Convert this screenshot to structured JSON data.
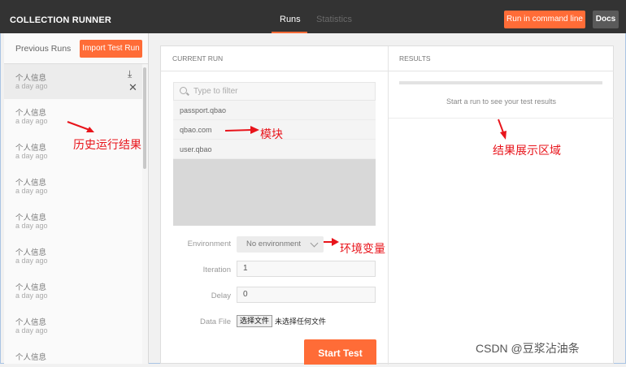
{
  "header": {
    "app_title": "COLLECTION RUNNER",
    "tabs": [
      {
        "label": "Runs",
        "active": true
      },
      {
        "label": "Statistics",
        "active": false
      }
    ],
    "run_cmd_label": "Run in command line",
    "docs_label": "Docs"
  },
  "sidebar": {
    "previous_runs_label": "Previous Runs",
    "import_label": "Import Test Run",
    "runs": [
      {
        "name": "个人信息",
        "time": "a day ago"
      },
      {
        "name": "个人信息",
        "time": "a day ago"
      },
      {
        "name": "个人信息",
        "time": "a day ago"
      },
      {
        "name": "个人信息",
        "time": "a day ago"
      },
      {
        "name": "个人信息",
        "time": "a day ago"
      },
      {
        "name": "个人信息",
        "time": "a day ago"
      },
      {
        "name": "个人信息",
        "time": "a day ago"
      },
      {
        "name": "个人信息",
        "time": "a day ago"
      },
      {
        "name": "个人信息",
        "time": ""
      }
    ],
    "download_icon": "download-icon",
    "close_icon": "close-icon"
  },
  "current_run": {
    "heading": "CURRENT RUN",
    "filter_placeholder": "Type to filter",
    "collections": [
      "passport.qbao",
      "qbao.com",
      "user.qbao"
    ],
    "environment_label": "Environment",
    "environment_value": "No environment",
    "iteration_label": "Iteration",
    "iteration_value": "1",
    "delay_label": "Delay",
    "delay_value": "0",
    "data_file_label": "Data File",
    "choose_file_label": "选择文件",
    "no_file_label": "未选择任何文件",
    "start_label": "Start Test"
  },
  "results": {
    "heading": "RESULTS",
    "message": "Start a run to see your test results"
  },
  "annotations": {
    "history": "历史运行结果",
    "module": "模块",
    "results_area": "结果展示区域",
    "env_var": "环境变量"
  },
  "watermark": "CSDN @豆浆沾油条",
  "colors": {
    "accent": "#ff6c37",
    "topbar": "#333333",
    "annotation": "#e8141b"
  }
}
